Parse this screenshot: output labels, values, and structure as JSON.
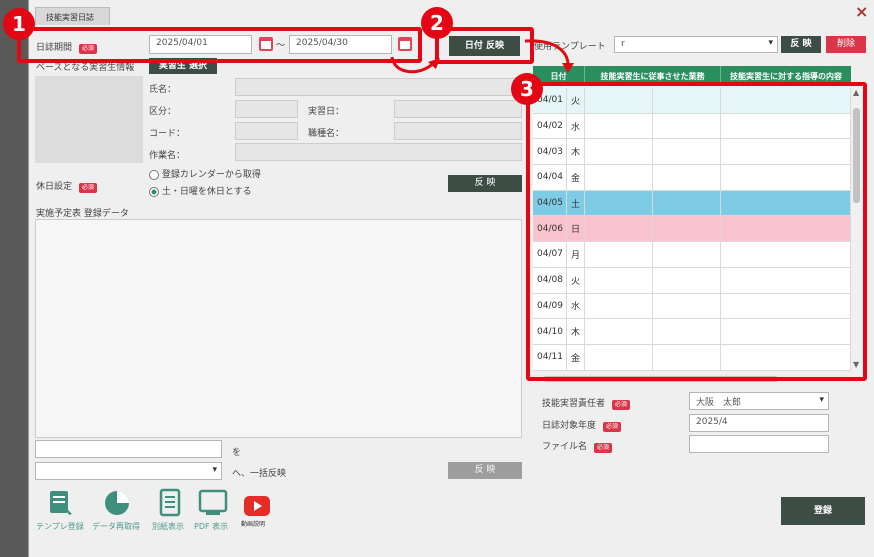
{
  "window": {
    "tab_title": "技能実習日誌",
    "close_label": "×"
  },
  "top": {
    "period_label": "日誌期間",
    "required": "必須",
    "date_from": "2025/04/01",
    "tilde": "〜",
    "date_to": "2025/04/30",
    "reflect_btn": "日付 反映"
  },
  "template": {
    "label": "使用テンプレート",
    "value": "r",
    "reflect": "反 映",
    "delete": "削除"
  },
  "base": {
    "label": "ベースとなる実習生情報",
    "select_btn": "実習生 選択",
    "name": "氏名：",
    "kubun": "区分：",
    "jisshubi": "実習日：",
    "code": "コード：",
    "shokushu": "職種名：",
    "sagyo": "作業名："
  },
  "holiday": {
    "label": "休日設定",
    "opt1": "登録カレンダーから取得",
    "opt2": "土・日曜を休日とする",
    "reflect": "反 映"
  },
  "plan": {
    "label": "実施予定表 登録データ",
    "wo": "を",
    "ikkatsu": "へ、一括反映",
    "reflect": "反 映"
  },
  "grid": {
    "headers": [
      "日付",
      "技能実習生に従事させた業務",
      "技能実習生に対する指導の内容"
    ],
    "rows": [
      {
        "date": "04/01",
        "dow": "火",
        "type": "today"
      },
      {
        "date": "04/02",
        "dow": "水",
        "type": "normal"
      },
      {
        "date": "04/03",
        "dow": "木",
        "type": "normal"
      },
      {
        "date": "04/04",
        "dow": "金",
        "type": "normal"
      },
      {
        "date": "04/05",
        "dow": "土",
        "type": "sat"
      },
      {
        "date": "04/06",
        "dow": "日",
        "type": "sun"
      },
      {
        "date": "04/07",
        "dow": "月",
        "type": "normal"
      },
      {
        "date": "04/08",
        "dow": "火",
        "type": "normal"
      },
      {
        "date": "04/09",
        "dow": "水",
        "type": "normal"
      },
      {
        "date": "04/10",
        "dow": "木",
        "type": "normal"
      },
      {
        "date": "04/11",
        "dow": "金",
        "type": "normal"
      }
    ],
    "row_colors": {
      "today": "#e6f6f6",
      "sat": "#7ecbe6",
      "sun": "#f9c3cd",
      "normal": "#ffffff"
    }
  },
  "bottom_right": {
    "sekinin_label": "技能実習責任者",
    "sekinin_value": "大阪　太郎",
    "nendo_label": "日誌対象年度",
    "nendo_value": "2025/4",
    "file_label": "ファイル名",
    "register": "登録"
  },
  "tools": [
    {
      "label": "テンプレ登録",
      "icon": "template-register-icon"
    },
    {
      "label": "データ再取得",
      "icon": "data-refetch-icon"
    },
    {
      "label": "別紙表示",
      "icon": "attachment-view-icon"
    },
    {
      "label": "PDF 表示",
      "icon": "pdf-view-icon"
    },
    {
      "label": "動画説明",
      "icon": "video-guide-icon"
    }
  ],
  "badges": [
    "1",
    "2",
    "3"
  ],
  "colors": {
    "accent": "#2a8f5e",
    "highlight": "#e30613",
    "dark_button": "#3d4d45"
  }
}
